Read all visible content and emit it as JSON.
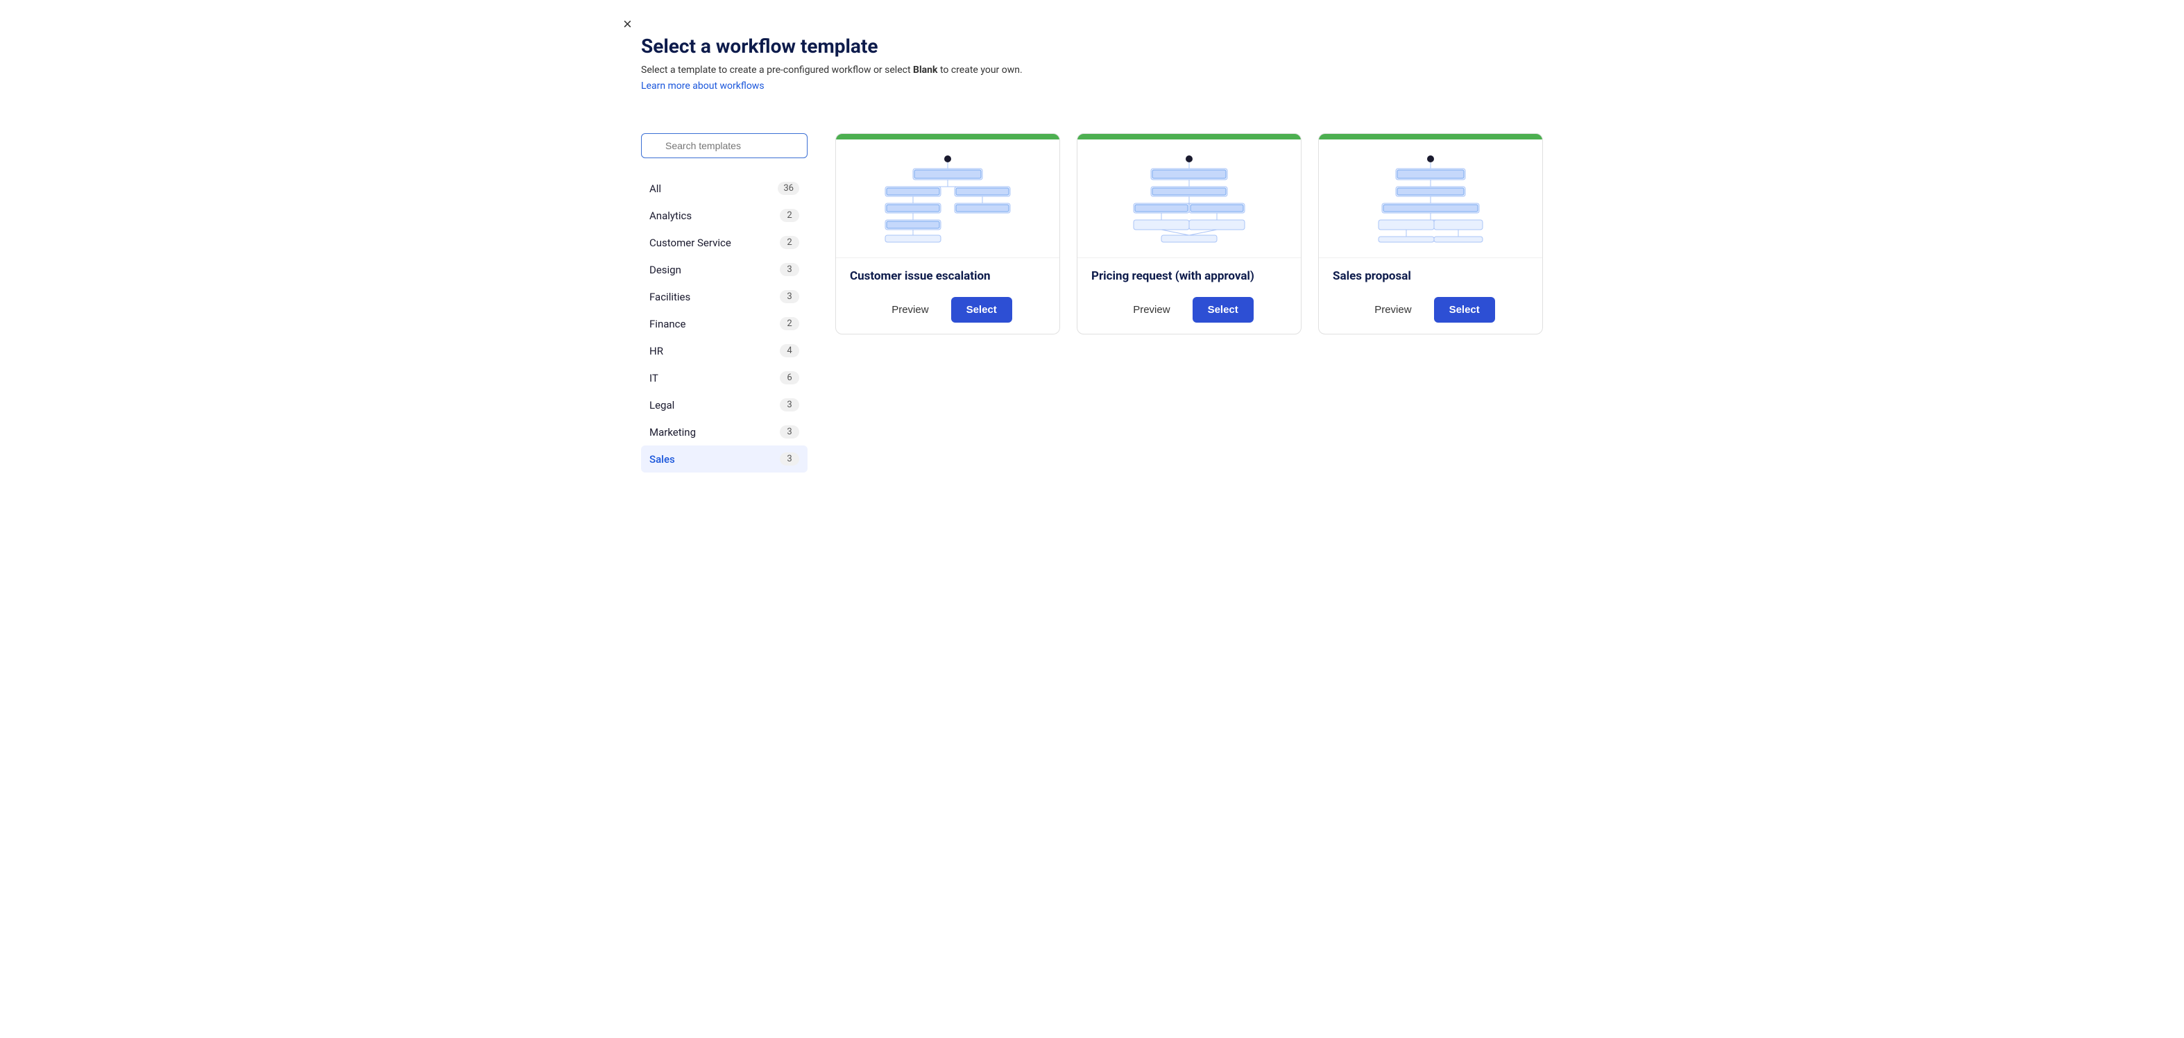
{
  "page": {
    "title": "Select a workflow template",
    "subtitle_plain": "Select a template to create a pre-configured workflow or select ",
    "subtitle_bold": "Blank",
    "subtitle_end": " to create your own.",
    "learn_more_label": "Learn more about workflows",
    "close_label": "×"
  },
  "search": {
    "placeholder": "Search templates"
  },
  "categories": [
    {
      "id": "all",
      "label": "All",
      "count": 36,
      "active": false
    },
    {
      "id": "analytics",
      "label": "Analytics",
      "count": 2,
      "active": false
    },
    {
      "id": "customer-service",
      "label": "Customer Service",
      "count": 2,
      "active": false
    },
    {
      "id": "design",
      "label": "Design",
      "count": 3,
      "active": false
    },
    {
      "id": "facilities",
      "label": "Facilities",
      "count": 3,
      "active": false
    },
    {
      "id": "finance",
      "label": "Finance",
      "count": 2,
      "active": false
    },
    {
      "id": "hr",
      "label": "HR",
      "count": 4,
      "active": false
    },
    {
      "id": "it",
      "label": "IT",
      "count": 6,
      "active": false
    },
    {
      "id": "legal",
      "label": "Legal",
      "count": 3,
      "active": false
    },
    {
      "id": "marketing",
      "label": "Marketing",
      "count": 3,
      "active": false
    },
    {
      "id": "sales",
      "label": "Sales",
      "count": 3,
      "active": true
    }
  ],
  "templates": [
    {
      "id": "customer-issue-escalation",
      "title": "Customer issue escalation",
      "preview_label": "Preview",
      "select_label": "Select"
    },
    {
      "id": "pricing-request-approval",
      "title": "Pricing request (with approval)",
      "preview_label": "Preview",
      "select_label": "Select"
    },
    {
      "id": "sales-proposal",
      "title": "Sales proposal",
      "preview_label": "Preview",
      "select_label": "Select"
    }
  ]
}
